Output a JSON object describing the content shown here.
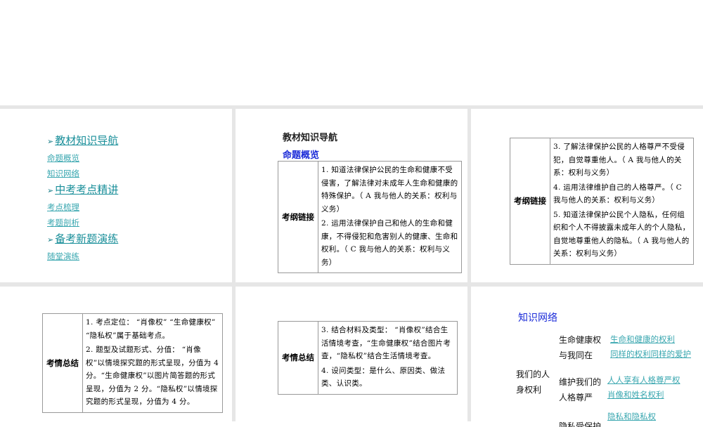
{
  "slide1": {
    "sections": [
      {
        "heading": "教材知识导航",
        "items": [
          "命题概览",
          "知识网络"
        ]
      },
      {
        "heading": "中考考点精讲",
        "items": [
          "考点梳理",
          "考题剖析"
        ]
      },
      {
        "heading": "备考新题演练",
        "items": [
          "随堂演练"
        ]
      }
    ]
  },
  "slide2": {
    "title": "教材知识导航",
    "subtitle": "命题概览",
    "label": "考纲链接",
    "items": [
      "1. 知道法律保护公民的生命和健康不受侵害，了解法律对未成年人生命和健康的特殊保护。（ A  我与他人的关系：权利与义务）",
      "2. 运用法律保护自己和他人的生命和健康，不得侵犯和危害别人的健康、生命和权利。（ C  我与他人的关系：权利与义务）"
    ]
  },
  "slide3": {
    "label": "考纲链接",
    "items": [
      "3. 了解法律保护公民的人格尊严不受侵犯，自觉尊重他人。（ A  我与他人的关系：权利与义务）",
      "4. 运用法律维护自己的人格尊严。（ C  我与他人的关系：权利与义务）",
      "5. 知道法律保护公民个人隐私，任何组织和个人不得披露未成年人的个人隐私，自觉地尊重他人的隐私。（ A 我与他人的关系：权利与义务）"
    ]
  },
  "slide4": {
    "label": "考情总结",
    "items": [
      "1. 考点定位：  “肖像权”  “生命健康权” “隐私权”属于基础考点。",
      "2. 题型及试题形式、分值：  “肖像权”以情境探究题的形式呈现，分值为 4 分。“生命健康权”以图片简答题的形式呈现，分值为 2 分。“隐私权”以情境探究题的形式呈现，分值为 4 分。"
    ]
  },
  "slide5": {
    "label": "考情总结",
    "items": [
      "3. 结合材料及类型：  “肖像权”结合生活情境考查，“生命健康权”结合图片考查，“隐私权”结合生活情境考查。",
      "4. 设问类型：是什么、原因类、做法类、认识类。"
    ]
  },
  "slide6": {
    "title": "知识网络",
    "root": [
      "我们的人",
      "身权利"
    ],
    "branches": [
      {
        "name": [
          "生命健康权",
          "与我同在"
        ],
        "links": [
          "生命和健康的权利",
          "同样的权利同样的爱护"
        ]
      },
      {
        "name": [
          "维护我们的",
          "人格尊严"
        ],
        "links": [
          "人人享有人格尊严权",
          "肖像和姓名权利"
        ]
      },
      {
        "name": [
          "隐私受保护"
        ],
        "links": [
          "隐私和隐私权"
        ]
      }
    ]
  }
}
